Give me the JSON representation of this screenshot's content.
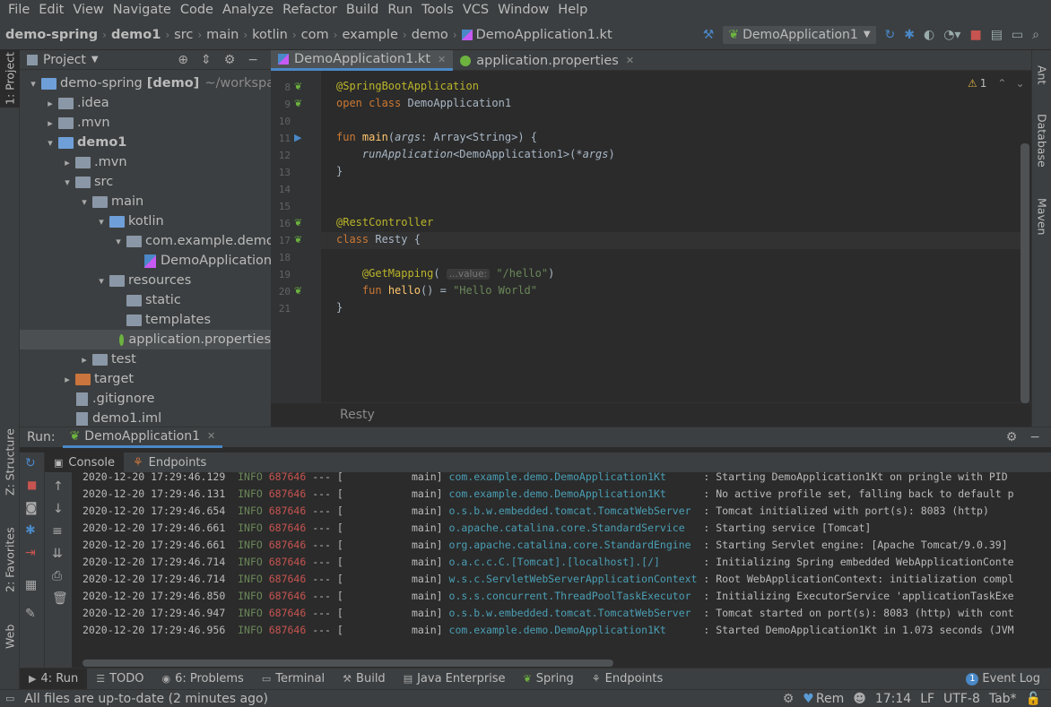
{
  "menu": [
    "File",
    "Edit",
    "View",
    "Navigate",
    "Code",
    "Analyze",
    "Refactor",
    "Build",
    "Run",
    "Tools",
    "VCS",
    "Window",
    "Help"
  ],
  "breadcrumbs": [
    "demo-spring",
    "demo1",
    "src",
    "main",
    "kotlin",
    "com",
    "example",
    "demo",
    "DemoApplication1.kt"
  ],
  "run_config": "DemoApplication1",
  "project_panel": {
    "title": "Project",
    "tree": [
      {
        "label": "demo-spring",
        "suffix": "[demo]",
        "path": "~/workspace",
        "depth": 0,
        "arrow": "▾",
        "icon": "module"
      },
      {
        "label": ".idea",
        "depth": 1,
        "arrow": "▸",
        "icon": "folder"
      },
      {
        "label": ".mvn",
        "depth": 1,
        "arrow": "▸",
        "icon": "folder"
      },
      {
        "label": "demo1",
        "depth": 1,
        "arrow": "▾",
        "icon": "module",
        "bold": true
      },
      {
        "label": ".mvn",
        "depth": 2,
        "arrow": "▸",
        "icon": "folder"
      },
      {
        "label": "src",
        "depth": 2,
        "arrow": "▾",
        "icon": "folder"
      },
      {
        "label": "main",
        "depth": 3,
        "arrow": "▾",
        "icon": "folder"
      },
      {
        "label": "kotlin",
        "depth": 4,
        "arrow": "▾",
        "icon": "folder-blue"
      },
      {
        "label": "com.example.demo",
        "depth": 5,
        "arrow": "▾",
        "icon": "folder"
      },
      {
        "label": "DemoApplication",
        "depth": 6,
        "arrow": "",
        "icon": "kotlin"
      },
      {
        "label": "resources",
        "depth": 4,
        "arrow": "▾",
        "icon": "folder"
      },
      {
        "label": "static",
        "depth": 5,
        "arrow": "",
        "icon": "folder"
      },
      {
        "label": "templates",
        "depth": 5,
        "arrow": "",
        "icon": "folder"
      },
      {
        "label": "application.properties",
        "depth": 5,
        "arrow": "",
        "icon": "spring",
        "selected": true
      },
      {
        "label": "test",
        "depth": 3,
        "arrow": "▸",
        "icon": "folder"
      },
      {
        "label": "target",
        "depth": 2,
        "arrow": "▸",
        "icon": "folder-orange"
      },
      {
        "label": ".gitignore",
        "depth": 2,
        "arrow": "",
        "icon": "file"
      },
      {
        "label": "demo1.iml",
        "depth": 2,
        "arrow": "",
        "icon": "file"
      }
    ]
  },
  "left_strip": {
    "project": "1: Project",
    "structure": "Z: Structure",
    "favorites": "2: Favorites",
    "web": "Web"
  },
  "right_strip": {
    "ant": "Ant",
    "database": "Database",
    "maven": "Maven"
  },
  "editor_tabs": [
    {
      "label": "DemoApplication1.kt",
      "active": true
    },
    {
      "label": "application.properties",
      "active": false
    }
  ],
  "editor": {
    "warning_count": "1",
    "line_numbers": [
      "8",
      "9",
      "10",
      "11",
      "12",
      "13",
      "14",
      "15",
      "16",
      "17",
      "18",
      "19",
      "20",
      "21"
    ],
    "lines": [
      {
        "n": "8",
        "html": "<span class='ann'>@SpringBootApplication</span>"
      },
      {
        "n": "9",
        "html": "<span class='kw'>open class</span> DemoApplication1"
      },
      {
        "n": "10",
        "html": ""
      },
      {
        "n": "11",
        "html": "<span class='kw'>fun</span> <span class='fn'>main</span>(<span class='it'>args</span>: Array&lt;String&gt;) {"
      },
      {
        "n": "12",
        "html": "    <span class='it'>runApplication</span>&lt;DemoApplication1&gt;(*<span class='it'>args</span>)"
      },
      {
        "n": "13",
        "html": "}"
      },
      {
        "n": "14",
        "html": ""
      },
      {
        "n": "15",
        "html": ""
      },
      {
        "n": "16",
        "html": "<span class='ann'>@RestController</span>"
      },
      {
        "n": "17",
        "html": "<span class='kw'>class</span> Resty {"
      },
      {
        "n": "18",
        "html": ""
      },
      {
        "n": "19",
        "html": "    <span class='ann'>@GetMapping</span>( <span class='hint'>...value:</span> <span class='str'>\"/hello\"</span>)"
      },
      {
        "n": "20",
        "html": "    <span class='kw'>fun</span> <span class='fn'>hello</span>() = <span class='str'>\"Hello World\"</span>"
      },
      {
        "n": "21",
        "html": "}"
      }
    ],
    "footer_breadcrumb": "Resty"
  },
  "run_panel": {
    "label": "Run:",
    "tab": "DemoApplication1",
    "subtabs": [
      "Console",
      "Endpoints"
    ],
    "logs": [
      {
        "ts": "2020-12-20 17:29:46.129",
        "lvl": "INFO",
        "pid": "687646",
        "thread": "main",
        "cls": "com.example.demo.DemoApplication1Kt",
        "msg": "Starting DemoApplication1Kt on pringle with PID"
      },
      {
        "ts": "2020-12-20 17:29:46.131",
        "lvl": "INFO",
        "pid": "687646",
        "thread": "main",
        "cls": "com.example.demo.DemoApplication1Kt",
        "msg": "No active profile set, falling back to default p"
      },
      {
        "ts": "2020-12-20 17:29:46.654",
        "lvl": "INFO",
        "pid": "687646",
        "thread": "main",
        "cls": "o.s.b.w.embedded.tomcat.TomcatWebServer",
        "msg": "Tomcat initialized with port(s): 8083 (http)"
      },
      {
        "ts": "2020-12-20 17:29:46.661",
        "lvl": "INFO",
        "pid": "687646",
        "thread": "main",
        "cls": "o.apache.catalina.core.StandardService",
        "msg": "Starting service [Tomcat]"
      },
      {
        "ts": "2020-12-20 17:29:46.661",
        "lvl": "INFO",
        "pid": "687646",
        "thread": "main",
        "cls": "org.apache.catalina.core.StandardEngine",
        "msg": "Starting Servlet engine: [Apache Tomcat/9.0.39]"
      },
      {
        "ts": "2020-12-20 17:29:46.714",
        "lvl": "INFO",
        "pid": "687646",
        "thread": "main",
        "cls": "o.a.c.c.C.[Tomcat].[localhost].[/]",
        "msg": "Initializing Spring embedded WebApplicationConte"
      },
      {
        "ts": "2020-12-20 17:29:46.714",
        "lvl": "INFO",
        "pid": "687646",
        "thread": "main",
        "cls": "w.s.c.ServletWebServerApplicationContext",
        "msg": "Root WebApplicationContext: initialization compl"
      },
      {
        "ts": "2020-12-20 17:29:46.850",
        "lvl": "INFO",
        "pid": "687646",
        "thread": "main",
        "cls": "o.s.s.concurrent.ThreadPoolTaskExecutor",
        "msg": "Initializing ExecutorService 'applicationTaskExe"
      },
      {
        "ts": "2020-12-20 17:29:46.947",
        "lvl": "INFO",
        "pid": "687646",
        "thread": "main",
        "cls": "o.s.b.w.embedded.tomcat.TomcatWebServer",
        "msg": "Tomcat started on port(s): 8083 (http) with cont"
      },
      {
        "ts": "2020-12-20 17:29:46.956",
        "lvl": "INFO",
        "pid": "687646",
        "thread": "main",
        "cls": "com.example.demo.DemoApplication1Kt",
        "msg": "Started DemoApplication1Kt in 1.073 seconds (JVM"
      }
    ]
  },
  "bottom_tabs": [
    "4: Run",
    "TODO",
    "6: Problems",
    "Terminal",
    "Build",
    "Java Enterprise",
    "Spring",
    "Endpoints"
  ],
  "event_log": {
    "count": "1",
    "label": "Event Log"
  },
  "status": {
    "message": "All files are up-to-date (2 minutes ago)",
    "theme": "Rem",
    "position": "17:14",
    "line_sep": "LF",
    "encoding": "UTF-8",
    "indent": "Tab*"
  },
  "colors": {
    "accent": "#4a88c7",
    "bg": "#2b2b2b",
    "panel": "#3c3f41",
    "spring": "#6db33f"
  }
}
